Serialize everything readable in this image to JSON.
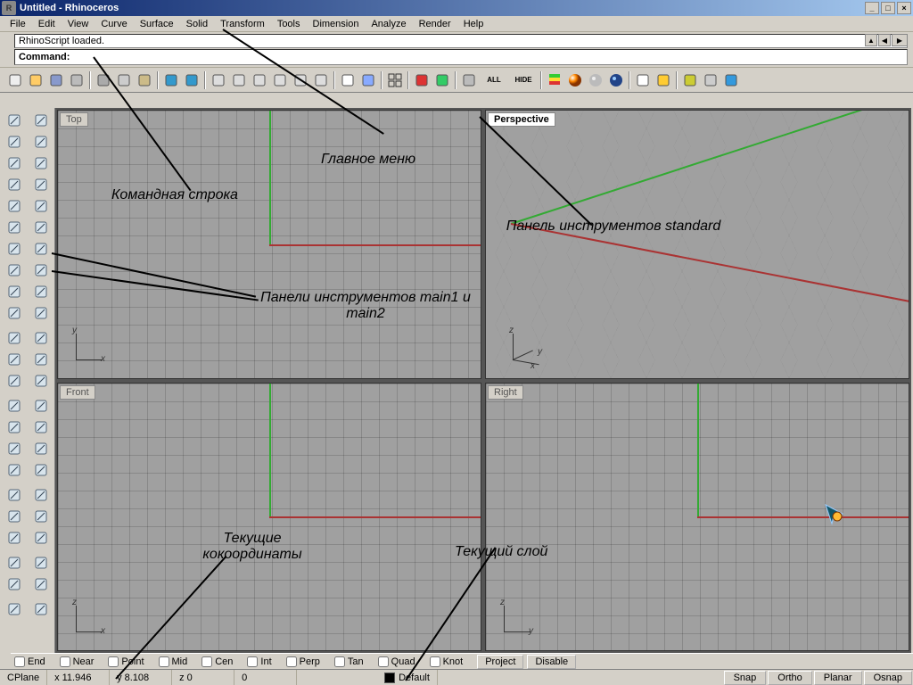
{
  "title": "Untitled - Rhinoceros",
  "menu": [
    "File",
    "Edit",
    "View",
    "Curve",
    "Surface",
    "Solid",
    "Transform",
    "Tools",
    "Dimension",
    "Analyze",
    "Render",
    "Help"
  ],
  "history": "RhinoScript loaded.",
  "prompt": "Command:",
  "viewports": {
    "top": "Top",
    "persp": "Perspective",
    "front": "Front",
    "right": "Right"
  },
  "axes": {
    "top": {
      "v": "y",
      "h": "x"
    },
    "persp": {
      "v": "z",
      "h": "y",
      "h2": "x"
    },
    "front": {
      "v": "z",
      "h": "x"
    },
    "right": {
      "v": "z",
      "h": "y"
    }
  },
  "osnap": {
    "items": [
      "End",
      "Near",
      "Point",
      "Mid",
      "Cen",
      "Int",
      "Perp",
      "Tan",
      "Quad",
      "Knot"
    ],
    "buttons": [
      "Project",
      "Disable"
    ]
  },
  "status": {
    "cplane": "CPlane",
    "x": "x 11.946",
    "y": "y 8.108",
    "z": "z 0",
    "extra": "0",
    "layer": "Default",
    "buttons": [
      "Snap",
      "Ortho",
      "Planar",
      "Osnap"
    ]
  },
  "toolbar_std": [
    "new",
    "open",
    "save",
    "print",
    "sep",
    "cut",
    "copy",
    "paste",
    "sep",
    "undo",
    "redo",
    "sep",
    "pan",
    "rotate",
    "zoom",
    "zoom-window",
    "zoom-extents",
    "zoom-sel",
    "sep",
    "wireframe",
    "shaded",
    "sep",
    "4view",
    "sep",
    "car",
    "layers",
    "sep",
    "lock",
    "all",
    "hide",
    "sep",
    "stack",
    "ball",
    "matte",
    "render",
    "sep",
    "sphere",
    "cone",
    "sep",
    "gears",
    "options",
    "help"
  ],
  "toolbar_left1": [
    "select",
    "point",
    "curve",
    "polyline",
    "circle",
    "arc",
    "rect",
    "polygon",
    "freeform",
    "spiral",
    "sep",
    "extrude",
    "revolve",
    "loft",
    "sep",
    "move",
    "rotate",
    "scale",
    "mirror",
    "sep",
    "trim",
    "split",
    "join",
    "sep",
    "dim",
    "text",
    "sep",
    "analyze"
  ],
  "toolbar_left2": [
    "lasso",
    "points",
    "lines",
    "curve2",
    "ellipse",
    "arc2",
    "slab",
    "star",
    "helix",
    "blend",
    "sep",
    "sweep",
    "rail",
    "patch",
    "sep",
    "copy",
    "array",
    "align",
    "orient",
    "sep",
    "fillet",
    "chamfer",
    "explode",
    "sep",
    "angle",
    "leader",
    "sep",
    "check"
  ],
  "annotations": {
    "main_menu": "Главное меню",
    "cmdline": "Командная строка",
    "std": "Панель инструментов standard",
    "main12": "Панели инструментов main1 и main2",
    "coords": "Текущие кокоординаты",
    "layer": "Текущий слой"
  }
}
